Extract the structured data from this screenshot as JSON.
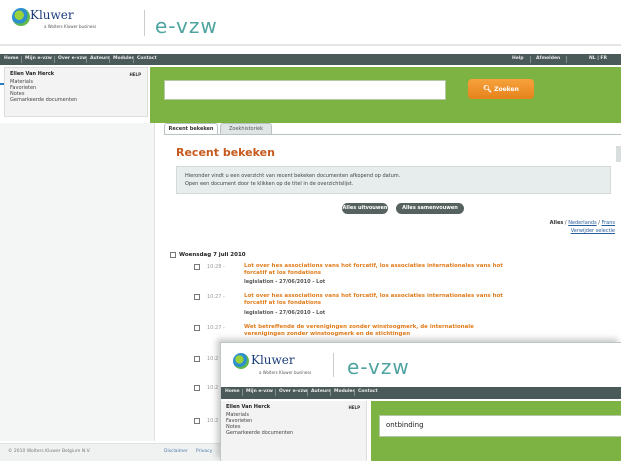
{
  "header": {
    "brand": "Kluwer",
    "brand_sub": "a Wolters Kluwer business",
    "app_title": "e-vzw"
  },
  "nav": {
    "items": [
      "Home",
      "Mijn e-vzw",
      "Over e-vzw",
      "Auteurs",
      "Modules",
      "Contact"
    ],
    "right_items": [
      "Help",
      "Afmelden",
      "NL | FR"
    ]
  },
  "left_menu": {
    "user": "Ellen Van Herck",
    "help": "HELP",
    "items": [
      "Materials",
      "Favorieten",
      "Notes",
      "Gemarkeerde documenten"
    ]
  },
  "search": {
    "value": "",
    "button": "Zoeken",
    "hint": ""
  },
  "tabs": [
    {
      "label": "Recent bekeken",
      "active": true
    },
    {
      "label": "Zoekhistoriek",
      "active": false
    }
  ],
  "main": {
    "title": "Recent bekeken",
    "info_lines": [
      "Hieronder vindt u een overzicht van recent bekeken documenten afkopend op datum.",
      "Open een document door te klikken op de titel in de overzichtslijst."
    ],
    "btn_open_all": "Alles uitvouwen",
    "btn_close_all": "Alles samenvouwen",
    "filter_label": "Alles",
    "filter_links": [
      "Nederlands",
      "Frans"
    ],
    "filter_link2": "Verwijder selectie",
    "group_date": "Woensdag 7 juli 2010",
    "entries": [
      {
        "time": "10:28 -",
        "title": "Lot over hes associations vans hot forcatif, los associaties internationales vans hot",
        "title2": "forcatif at los fondations",
        "sub": "legislation - 27/06/2010 - Lot"
      },
      {
        "time": "10:27 -",
        "title": "Lot over hes associations vans hot forcatif, los associaties internationales vans hot",
        "title2": "forcatif at los fondations",
        "sub": "legislation - 27/06/2010 - Lot"
      },
      {
        "time": "10:27 -",
        "title": "Wet betreffende de verenigingen zonder winstoogmerk, de internationale",
        "title2": "verenigingen zonder winstoogmerk en de stichtingen",
        "sub": ""
      }
    ],
    "partial_times": [
      "10:2",
      "10:2",
      "10:2"
    ]
  },
  "footer": {
    "copyright": "© 2010 Wolters Kluwer Belgium N.V.",
    "links": [
      "Disclaimer",
      "Privacy"
    ]
  },
  "overlay": {
    "brand": "Kluwer",
    "brand_sub": "a Wolters Kluwer business",
    "app_title": "e-vzw",
    "nav_items": [
      "Home",
      "Mijn e-vzw",
      "Over e-vzw",
      "Auteurs",
      "Modules",
      "Contact"
    ],
    "user": "Ellen Van Herck",
    "help": "HELP",
    "menu_items": [
      "Materials",
      "Favorieten",
      "Notes",
      "Gemarkeerde documenten"
    ],
    "search_value": "ontbinding"
  }
}
